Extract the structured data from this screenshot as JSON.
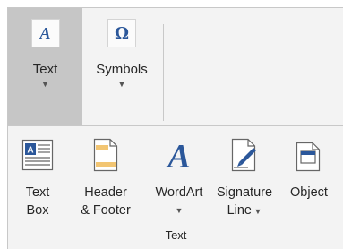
{
  "top_row": {
    "text_button": {
      "label": "Text",
      "icon": "wordart-a-icon"
    },
    "symbols_button": {
      "label": "Symbols",
      "icon": "omega-icon"
    }
  },
  "text_group": {
    "label": "Text",
    "buttons": [
      {
        "line1": "Text",
        "line2": "Box",
        "icon": "text-box-icon"
      },
      {
        "line1": "Header",
        "line2": "& Footer",
        "icon": "header-footer-icon"
      },
      {
        "line1": "WordArt",
        "line2": "",
        "icon": "wordart-icon"
      },
      {
        "line1": "Signature",
        "line2": "Line",
        "icon": "signature-line-icon"
      },
      {
        "line1": "Object",
        "line2": "",
        "icon": "object-icon"
      }
    ]
  },
  "colors": {
    "accent": "#2b579a",
    "selected": "#c6c6c6",
    "header_band": "#f2c572"
  }
}
